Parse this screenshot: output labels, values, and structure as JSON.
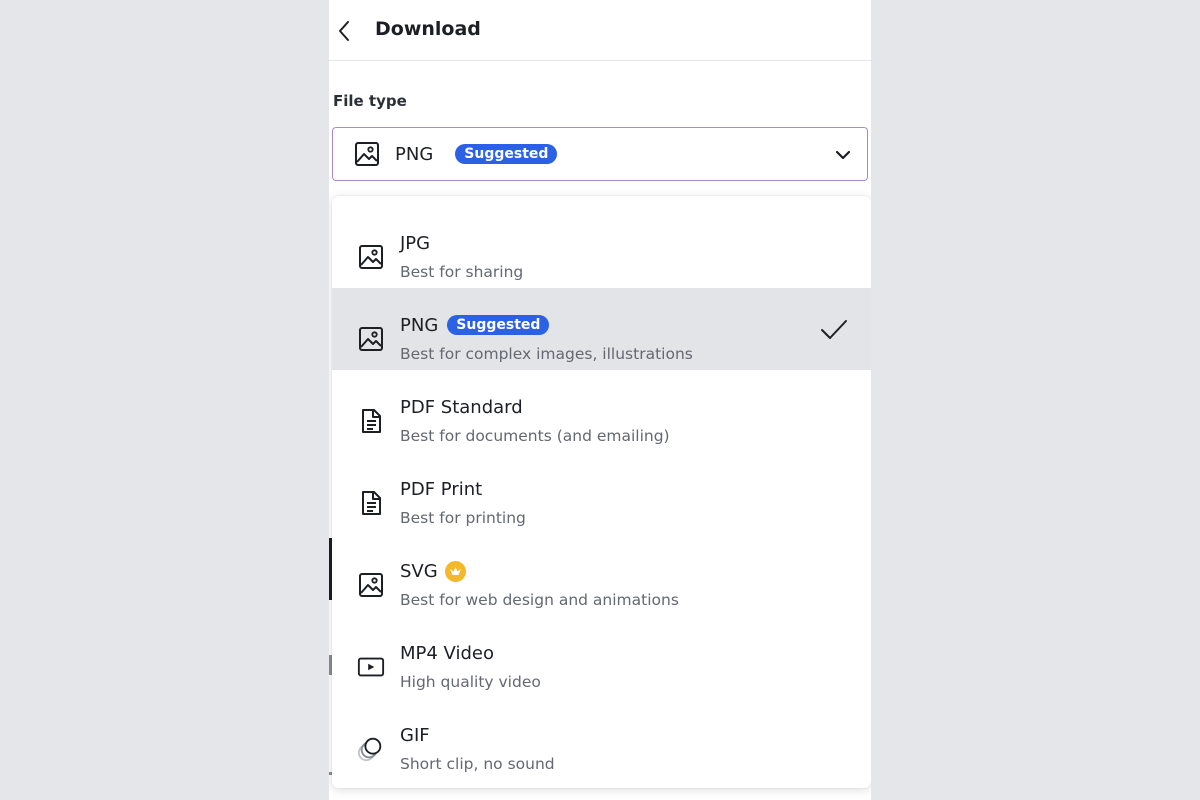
{
  "header": {
    "title": "Download"
  },
  "file_type": {
    "label": "File type",
    "selected_value": "PNG",
    "selected_badge": "Suggested"
  },
  "options": [
    {
      "name": "JPG",
      "description": "Best for sharing",
      "icon": "image-icon"
    },
    {
      "name": "PNG",
      "description": "Best for complex images, illustrations",
      "icon": "image-icon",
      "badge": "Suggested",
      "selected": true
    },
    {
      "name": "PDF Standard",
      "description": "Best for documents (and emailing)",
      "icon": "document-icon"
    },
    {
      "name": "PDF Print",
      "description": "Best for printing",
      "icon": "document-icon"
    },
    {
      "name": "SVG",
      "description": "Best for web design and animations",
      "icon": "image-icon",
      "premium": "crown-icon"
    },
    {
      "name": "MP4 Video",
      "description": "High quality video",
      "icon": "video-play-icon"
    },
    {
      "name": "GIF",
      "description": "Short clip, no sound",
      "icon": "gif-circles-icon"
    }
  ],
  "colors": {
    "badge_bg": "#2b61e4",
    "selected_row_bg": "#e2e4e8",
    "select_border": "#a78bcd",
    "crown_bg": "#f4b82a"
  }
}
